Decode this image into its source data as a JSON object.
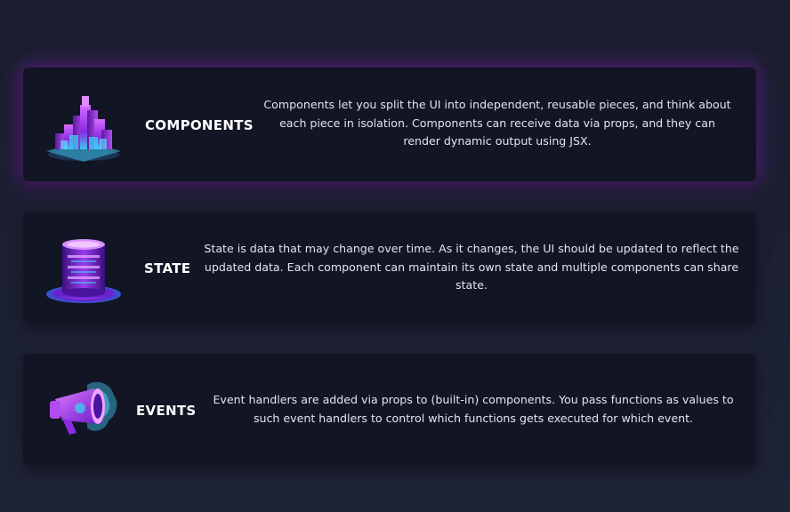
{
  "colors": {
    "background": "#1c2033",
    "card": "#121524",
    "glow": "#9628d2",
    "icon_purple": "#8a2be2",
    "icon_cyan": "#4fd1f5"
  },
  "features": [
    {
      "icon": "cube-pyramid-icon",
      "title": "COMPONENTS",
      "description": "Components let you split the UI into independent, reusable pieces, and think about each piece in isolation. Components can receive data via props, and they can render dynamic output using JSX.",
      "active": true
    },
    {
      "icon": "database-cylinder-icon",
      "title": "STATE",
      "description": "State is data that may change over time. As it changes, the UI should be updated to reflect the updated data. Each component can maintain its own state and multiple components can share state.",
      "active": false
    },
    {
      "icon": "megaphone-icon",
      "title": "EVENTS",
      "description": "Event handlers are added via props to (built-in) components. You pass functions as values to such event handlers to control which functions gets executed for which event.",
      "active": false
    }
  ]
}
